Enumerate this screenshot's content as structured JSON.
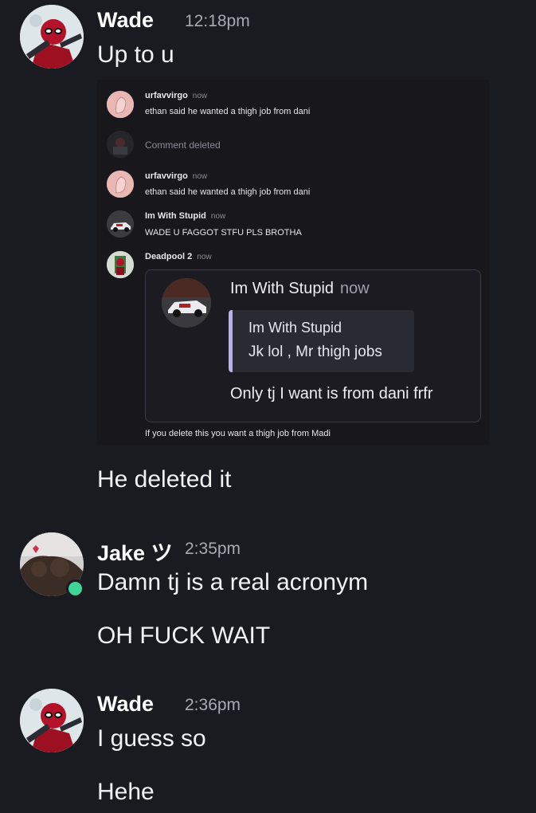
{
  "groups": [
    {
      "author": "Wade",
      "time": "12:18pm",
      "messages": [
        "Up to u",
        "He deleted it"
      ]
    },
    {
      "author": "Jake ツ",
      "time": "2:35pm",
      "messages": [
        "Damn tj is a real acronym",
        "OH FUCK WAIT"
      ]
    },
    {
      "author": "Wade",
      "time": "2:36pm",
      "messages": [
        "I guess so",
        "Hehe"
      ]
    }
  ],
  "embed": {
    "comments": [
      {
        "name": "urfavvirgo",
        "time": "now",
        "text": "ethan said he wanted a thigh job from dani"
      },
      {
        "deleted": "Comment deleted"
      },
      {
        "name": "urfavvirgo",
        "time": "now",
        "text": "ethan said he wanted a thigh job from dani"
      },
      {
        "name": "Im With Stupid",
        "time": "now",
        "text": "WADE U FAGGOT STFU PLS BROTHA"
      },
      {
        "name": "Deadpool 2",
        "time": "now"
      }
    ],
    "card": {
      "name": "Im With Stupid",
      "time": "now",
      "quote_name": "Im With Stupid",
      "quote_text": "Jk lol , Mr thigh jobs",
      "body": "Only tj I want is from dani frfr"
    },
    "caption": "If you delete this you want a thigh job from Madi"
  },
  "colors": {
    "background": "#1a1a21",
    "online_status": "#3fd49a",
    "quote_bar": "#b9b0f0"
  }
}
